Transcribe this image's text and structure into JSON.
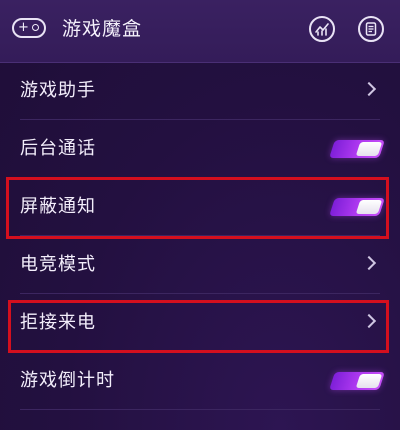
{
  "header": {
    "title": "游戏魔盒",
    "gamepad_glyph": "+",
    "icons": [
      "gamepad-icon",
      "stats-icon",
      "document-icon"
    ]
  },
  "settings": {
    "items": [
      {
        "label": "游戏助手",
        "control": "chevron"
      },
      {
        "label": "后台通话",
        "control": "toggle",
        "enabled": true
      },
      {
        "label": "屏蔽通知",
        "control": "toggle",
        "enabled": true
      },
      {
        "label": "电竞模式",
        "control": "chevron"
      },
      {
        "label": "拒接来电",
        "control": "chevron"
      },
      {
        "label": "游戏倒计时",
        "control": "toggle",
        "enabled": true
      }
    ]
  },
  "colors": {
    "background": "#24113f",
    "header": "#3a2161",
    "toggle_on": "#b23bf2",
    "highlight": "#d40f1e"
  }
}
